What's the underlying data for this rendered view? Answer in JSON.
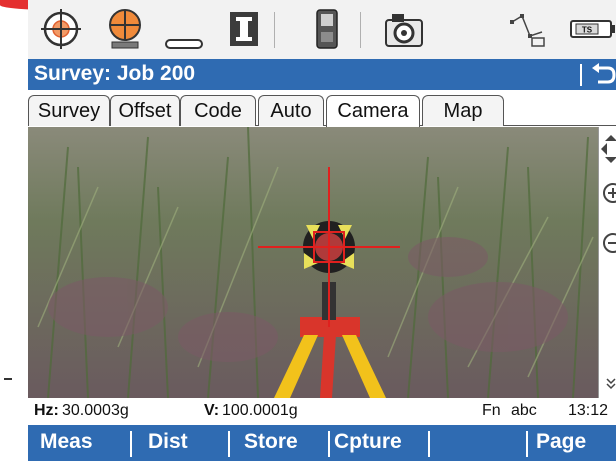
{
  "toolbar": {
    "icons": [
      "target-icon",
      "instrument-icon",
      "keyboard-icon",
      "text-cursor-icon",
      "controller-icon",
      "camera-icon",
      "map-sketch-icon",
      "ts-battery-icon"
    ],
    "ts_label": "TS"
  },
  "title": "Survey: Job 200",
  "tabs": [
    "Survey",
    "Offset",
    "Code",
    "Auto",
    "Camera",
    "Map"
  ],
  "active_tab": "Camera",
  "status": {
    "hz_label": "Hz:",
    "hz_value": "30.0003g",
    "v_label": "V:",
    "v_value": "100.0001g",
    "fn": "Fn",
    "input_mode": "abc",
    "time": "13:12"
  },
  "softkeys": [
    "Meas",
    "Dist",
    "Store",
    "Cpture",
    "Page"
  ],
  "colors": {
    "bar_blue": "#2f6bb2",
    "crosshair": "#e0201e",
    "tripod_red": "#d9352b",
    "tripod_yellow": "#f2c21b"
  }
}
